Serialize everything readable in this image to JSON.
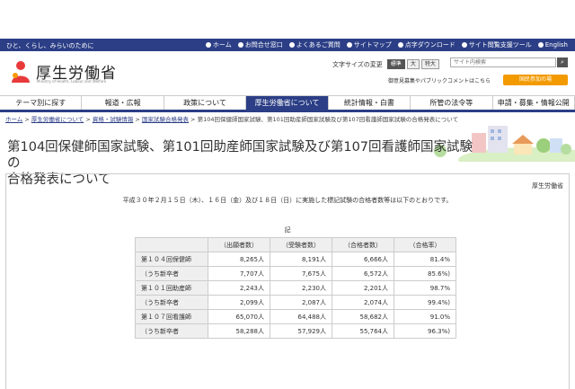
{
  "top_bar": {
    "tagline": "ひと、くらし、みらいのために",
    "links": [
      {
        "label": "ホーム"
      },
      {
        "label": "お問合せ窓口"
      },
      {
        "label": "よくあるご質問"
      },
      {
        "label": "サイトマップ"
      },
      {
        "label": "点字ダウンロード"
      },
      {
        "label": "サイト閲覧支援ツール"
      },
      {
        "label": "English"
      }
    ],
    "color": "#2b3e86"
  },
  "header": {
    "logo_title": "厚生労働省",
    "logo_subtitle": "Ministry of Health, Labour and Welfare",
    "font_size_label": "文字サイズの変更",
    "font_sizes": [
      "標準",
      "大",
      "特大"
    ],
    "search_placeholder": "サイト内検索",
    "search_icon": "search-icon",
    "public_comment_link": "御意見募集やパブリックコメントはこちら",
    "participation_button": "国民参加の場",
    "accent_color": "#f39a00"
  },
  "global_nav": [
    {
      "label": "テーマ別に探す"
    },
    {
      "label": "報道・広報"
    },
    {
      "label": "政策について"
    },
    {
      "label": "厚生労働省について"
    },
    {
      "label": "統計情報・白書"
    },
    {
      "label": "所管の法令等"
    },
    {
      "label": "申請・募集・情報公開"
    }
  ],
  "breadcrumb": {
    "items": [
      "ホーム",
      "厚生労働省について",
      "資格・試験情報",
      "国家試験合格発表"
    ],
    "separator": ">",
    "current": "第104回保健師国家試験、第101回助産師国家試験及び第107回看護師国家試験の合格発表について"
  },
  "page": {
    "title_line1": "第104回保健師国家試験、第101回助産師国家試験及び第107回看護師国家試験の",
    "title_line2": "合格発表について",
    "author": "厚生労働省",
    "lead": "平成３０年２月１５日（木）、１６日（金）及び１８日（日）に実施した標記試験の合格者数等は以下のとおりです。",
    "ki": "記"
  },
  "results_table": {
    "headers": [
      "（出願者数）",
      "（受験者数）",
      "（合格者数）",
      "（合格率）"
    ],
    "rows": [
      {
        "label": "第１０４回保健師",
        "cells": [
          "8,265人",
          "8,191人",
          "6,666人",
          "81.4%"
        ]
      },
      {
        "label": "（うち新卒者",
        "cells": [
          "7,707人",
          "7,675人",
          "6,572人",
          "85.6%)"
        ]
      },
      {
        "label": "第１０１回助産師",
        "cells": [
          "2,243人",
          "2,230人",
          "2,201人",
          "98.7%"
        ]
      },
      {
        "label": "（うち新卒者",
        "cells": [
          "2,099人",
          "2,087人",
          "2,074人",
          "99.4%)"
        ]
      },
      {
        "label": "第１０７回看護師",
        "cells": [
          "65,070人",
          "64,488人",
          "58,682人",
          "91.0%"
        ]
      },
      {
        "label": "（うち新卒者",
        "cells": [
          "58,288人",
          "57,929人",
          "55,764人",
          "96.3%)"
        ]
      }
    ]
  }
}
